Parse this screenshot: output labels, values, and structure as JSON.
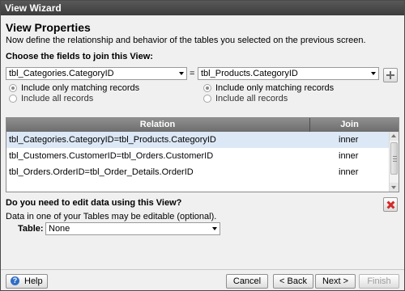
{
  "window": {
    "title": "View Wizard"
  },
  "header": {
    "title": "View Properties",
    "subtitle": "Now define the relationship and behavior of the tables you selected on the previous screen."
  },
  "join": {
    "section_label": "Choose the fields to join this View:",
    "left_field": "tbl_Categories.CategoryID",
    "operator": "=",
    "right_field": "tbl_Products.CategoryID",
    "left_options": [
      {
        "label": "Include only matching records",
        "checked": true
      },
      {
        "label": "Include all records",
        "checked": false
      }
    ],
    "right_options": [
      {
        "label": "Include only matching records",
        "checked": true
      },
      {
        "label": "Include all records",
        "checked": false
      }
    ],
    "add_icon": "plus-icon"
  },
  "relations": {
    "columns": [
      "Relation",
      "Join"
    ],
    "rows": [
      {
        "relation": "tbl_Categories.CategoryID=tbl_Products.CategoryID",
        "join": "inner",
        "selected": true
      },
      {
        "relation": "tbl_Customers.CustomerID=tbl_Orders.CustomerID",
        "join": "inner",
        "selected": false
      },
      {
        "relation": "tbl_Orders.OrderID=tbl_Order_Details.OrderID",
        "join": "inner",
        "selected": false
      }
    ]
  },
  "edit": {
    "question": "Do you need to edit data using this View?",
    "note": "Data in one of your Tables may be editable (optional).",
    "table_label": "Table:",
    "table_value": "None",
    "delete_icon": "red-x-icon"
  },
  "footer": {
    "help": "Help",
    "cancel": "Cancel",
    "back": "< Back",
    "next": "Next >",
    "finish": "Finish"
  },
  "colors": {
    "titlebar": "#3c3c3c",
    "grid_header": "#7a7a7a",
    "selected_row": "#dde8f6",
    "delete_x": "#d42a2a"
  }
}
